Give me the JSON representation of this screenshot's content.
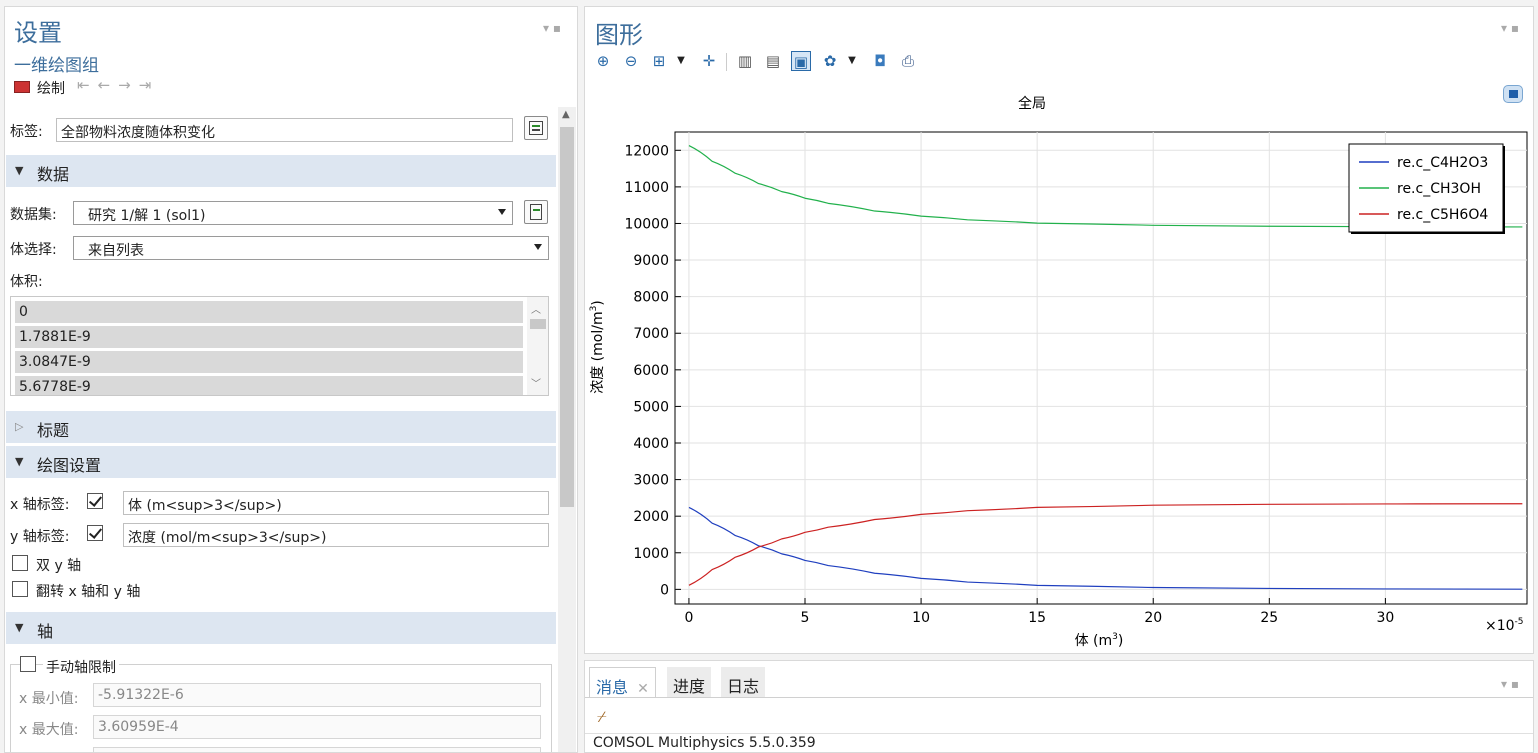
{
  "left": {
    "title": "设置",
    "subtitle": "一维绘图组",
    "toolbar": {
      "plot_label": "绘制"
    },
    "label_field": {
      "label": "标签:",
      "value": "全部物料浓度随体积变化"
    },
    "sections": {
      "data": "数据",
      "title": "标题",
      "plot_settings": "绘图设置",
      "axis": "轴"
    },
    "dataset": {
      "label": "数据集:",
      "value": "研究 1/解 1 (sol1)"
    },
    "volume_selection": {
      "label": "体选择:",
      "value": "来自列表"
    },
    "volumes": {
      "label": "体积:",
      "items": [
        "0",
        "1.7881E-9",
        "3.0847E-9",
        "5.6778E-9"
      ]
    },
    "x_axis_label": {
      "label": "x 轴标签:",
      "checked": true,
      "value": "体 (m<sup>3</sup>)"
    },
    "y_axis_label": {
      "label": "y 轴标签:",
      "checked": true,
      "value": "浓度 (mol/m<sup>3</sup>)"
    },
    "dual_y": {
      "label": "双 y 轴",
      "checked": false
    },
    "flip_xy": {
      "label": "翻转 x 轴和 y 轴",
      "checked": false
    },
    "manual_limits": {
      "label": "手动轴限制",
      "checked": false
    },
    "x_min": {
      "label": "x 最小值:",
      "value": "-5.91322E-6"
    },
    "x_max": {
      "label": "x 最大值:",
      "value": "3.60959E-4"
    }
  },
  "right": {
    "title": "图形",
    "colors": {
      "blue": "#1f3fbf",
      "green": "#22b14c",
      "red": "#cc2222"
    }
  },
  "chart_data": {
    "type": "line",
    "title": "全局",
    "xlabel_main": "体 (m",
    "xlabel_sup": "3",
    "xlabel_end": ")",
    "ylabel_main": "浓度 (mol/m",
    "ylabel_sup": "3",
    "ylabel_end": ")",
    "x_multiplier": "×10",
    "x_multiplier_exp": "-5",
    "xlim": [
      -0.6,
      36.1
    ],
    "ylim": [
      -400,
      12500
    ],
    "xticks": [
      0,
      5,
      10,
      15,
      20,
      25,
      30
    ],
    "yticks": [
      0,
      1000,
      2000,
      3000,
      4000,
      5000,
      6000,
      7000,
      8000,
      9000,
      10000,
      11000,
      12000
    ],
    "grid": true,
    "legend_position": "top-right",
    "series": [
      {
        "name": "re.c_C4H2O3",
        "color": "#1f3fbf",
        "x": [
          0,
          1,
          2,
          3,
          4,
          5,
          6,
          8,
          10,
          12,
          15,
          20,
          25,
          30,
          35.9
        ],
        "y": [
          2240,
          1810,
          1470,
          1190,
          970,
          790,
          650,
          440,
          300,
          200,
          110,
          50,
          25,
          12,
          5
        ]
      },
      {
        "name": "re.c_CH3OH",
        "color": "#22b14c",
        "x": [
          0,
          1,
          2,
          3,
          4,
          5,
          6,
          8,
          10,
          12,
          15,
          20,
          25,
          30,
          35.9
        ],
        "y": [
          12130,
          11700,
          11370,
          11090,
          10870,
          10690,
          10550,
          10340,
          10200,
          10100,
          10010,
          9950,
          9925,
          9912,
          9905
        ]
      },
      {
        "name": "re.c_C5H6O4",
        "color": "#cc2222",
        "x": [
          0,
          1,
          2,
          3,
          4,
          5,
          6,
          8,
          10,
          12,
          15,
          20,
          25,
          30,
          35.9
        ],
        "y": [
          110,
          540,
          880,
          1160,
          1380,
          1560,
          1700,
          1910,
          2050,
          2150,
          2240,
          2300,
          2325,
          2335,
          2340
        ]
      }
    ]
  },
  "bottom": {
    "tabs": [
      "消息",
      "进度",
      "日志"
    ],
    "message": "COMSOL Multiphysics 5.5.0.359"
  }
}
